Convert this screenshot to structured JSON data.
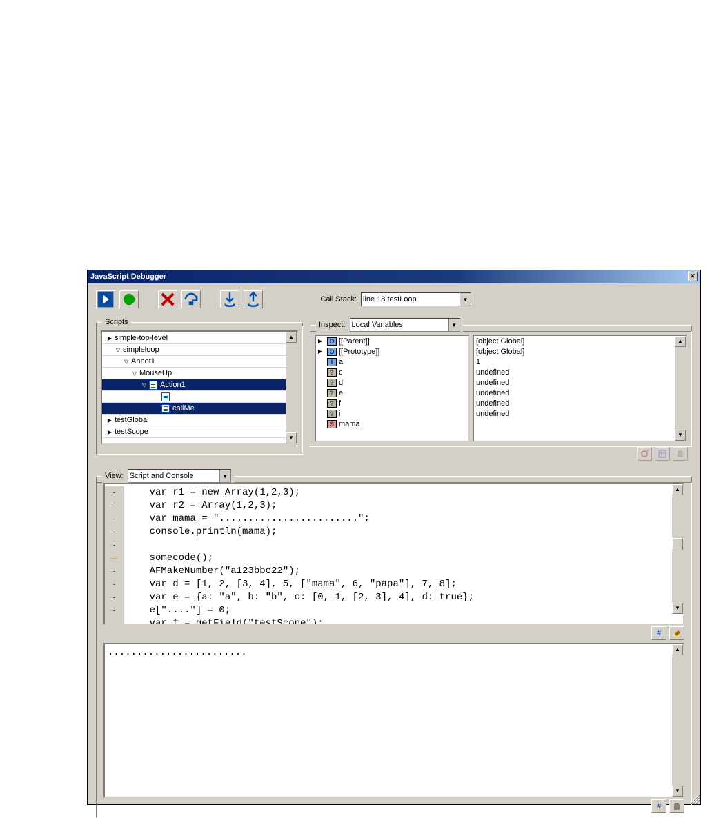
{
  "title": "JavaScript Debugger",
  "callStack": {
    "label": "Call Stack:",
    "value": "line 18 testLoop"
  },
  "scriptsGroup": {
    "legend": "Scripts"
  },
  "inspectGroup": {
    "legend": "Inspect:",
    "value": "Local Variables"
  },
  "viewGroup": {
    "legend": "View:",
    "value": "Script and Console"
  },
  "scriptsTree": [
    {
      "indent": 1,
      "tw": "▶",
      "label": "simple-top-level"
    },
    {
      "indent": 2,
      "tw": "▽",
      "label": "simpleloop"
    },
    {
      "indent": 3,
      "tw": "▽",
      "label": "Annot1"
    },
    {
      "indent": 4,
      "tw": "▽",
      "label": "MouseUp"
    },
    {
      "indent": 5,
      "tw": "▽",
      "label": "Action1",
      "sel": true,
      "docicon": true
    },
    {
      "indent": 6,
      "tw": "",
      "label": "",
      "docicon": true
    },
    {
      "indent": 6,
      "tw": "",
      "label": "callMe",
      "sel": true,
      "docicon": true
    },
    {
      "indent": 1,
      "tw": "▶",
      "label": "testGlobal"
    },
    {
      "indent": 1,
      "tw": "▶",
      "label": "testScope"
    }
  ],
  "inspectVars": [
    {
      "tri": "▶",
      "icon": "O",
      "name": "[[Parent]]",
      "value": "[object Global]"
    },
    {
      "tri": "▶",
      "icon": "O",
      "name": "[[Prototype]]",
      "value": "[object Global]"
    },
    {
      "tri": "",
      "icon": "I",
      "name": "a",
      "value": "1"
    },
    {
      "tri": "",
      "icon": "?",
      "name": "c",
      "value": "undefined"
    },
    {
      "tri": "",
      "icon": "?",
      "name": "d",
      "value": "undefined"
    },
    {
      "tri": "",
      "icon": "?",
      "name": "e",
      "value": "undefined"
    },
    {
      "tri": "",
      "icon": "?",
      "name": "f",
      "value": "undefined"
    },
    {
      "tri": "",
      "icon": "?",
      "name": "i",
      "value": "undefined"
    },
    {
      "tri": "",
      "icon": "S",
      "name": "mama",
      "value": ""
    }
  ],
  "code": {
    "lines": [
      {
        "mark": "-",
        "text": "    var r1 = new Array(1,2,3);"
      },
      {
        "mark": "-",
        "text": "    var r2 = Array(1,2,3);"
      },
      {
        "mark": "-",
        "text": "    var mama = \"........................\";"
      },
      {
        "mark": "-",
        "text": "    console.println(mama);"
      },
      {
        "mark": "-",
        "text": ""
      },
      {
        "mark": "⇨",
        "text": "    somecode();"
      },
      {
        "mark": "-",
        "text": "    AFMakeNumber(\"a123bbc22\");"
      },
      {
        "mark": "-",
        "text": "    var d = [1, 2, [3, 4], 5, [\"mama\", 6, \"papa\"], 7, 8];"
      },
      {
        "mark": "-",
        "text": "    var e = {a: \"a\", b: \"b\", c: [0, 1, [2, 3], 4], d: true};"
      },
      {
        "mark": "-",
        "text": "    e[\"....\"] = 0;"
      },
      {
        "mark": "-",
        "text": "    var f = getField(\"testScope\");"
      }
    ]
  },
  "consoleOutput": "........................",
  "icons": {
    "hash": "#",
    "pencil": "✎",
    "disk": "🖫"
  }
}
